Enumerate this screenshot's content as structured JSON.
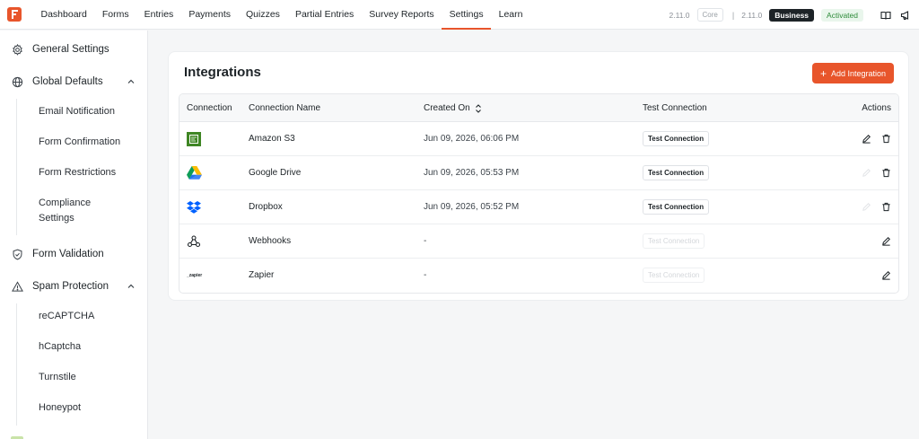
{
  "nav": {
    "items": [
      {
        "label": "Dashboard"
      },
      {
        "label": "Forms"
      },
      {
        "label": "Entries"
      },
      {
        "label": "Payments"
      },
      {
        "label": "Quizzes"
      },
      {
        "label": "Partial Entries"
      },
      {
        "label": "Survey Reports"
      },
      {
        "label": "Settings",
        "active": true
      },
      {
        "label": "Learn"
      }
    ],
    "core_version": "2.11.0",
    "core_label": "Core",
    "separator": "|",
    "pro_version": "2.11.0",
    "plan_label": "Business",
    "status_label": "Activated",
    "icons": [
      "book-icon",
      "megaphone-icon"
    ]
  },
  "sidebar": {
    "general_settings": "General Settings",
    "global_defaults": "Global Defaults",
    "global_defaults_children": [
      "Email Notification",
      "Form Confirmation",
      "Form Restrictions",
      "Compliance Settings"
    ],
    "form_validation": "Form Validation",
    "spam_protection": "Spam Protection",
    "spam_protection_children": [
      "reCAPTCHA",
      "hCaptcha",
      "Turnstile",
      "Honeypot"
    ]
  },
  "integrations": {
    "title": "Integrations",
    "add_button": "Add Integration",
    "add_icon": "+",
    "columns": {
      "connection": "Connection",
      "name": "Connection Name",
      "created": "Created On",
      "test": "Test Connection",
      "actions": "Actions"
    },
    "rows": [
      {
        "icon": "amazon-s3-icon",
        "name": "Amazon S3",
        "created": "Jun 09, 2026, 06:06 PM",
        "test": "Test Connection",
        "test_enabled": true,
        "edit_enabled": true,
        "deletable": true
      },
      {
        "icon": "google-drive-icon",
        "name": "Google Drive",
        "created": "Jun 09, 2026, 05:53 PM",
        "test": "Test Connection",
        "test_enabled": true,
        "edit_enabled": false,
        "deletable": true
      },
      {
        "icon": "dropbox-icon",
        "name": "Dropbox",
        "created": "Jun 09, 2026, 05:52 PM",
        "test": "Test Connection",
        "test_enabled": true,
        "edit_enabled": false,
        "deletable": true
      },
      {
        "icon": "webhooks-icon",
        "name": "Webhooks",
        "created": "-",
        "test": "Test Connection",
        "test_enabled": false,
        "edit_enabled": true,
        "deletable": false
      },
      {
        "icon": "zapier-icon",
        "icon_text": "_zapier",
        "name": "Zapier",
        "created": "-",
        "test": "Test Connection",
        "test_enabled": false,
        "edit_enabled": true,
        "deletable": false
      }
    ]
  },
  "colors": {
    "brand": "#e8552b",
    "dark": "#1d2327",
    "activated": "#2e8b3a"
  }
}
